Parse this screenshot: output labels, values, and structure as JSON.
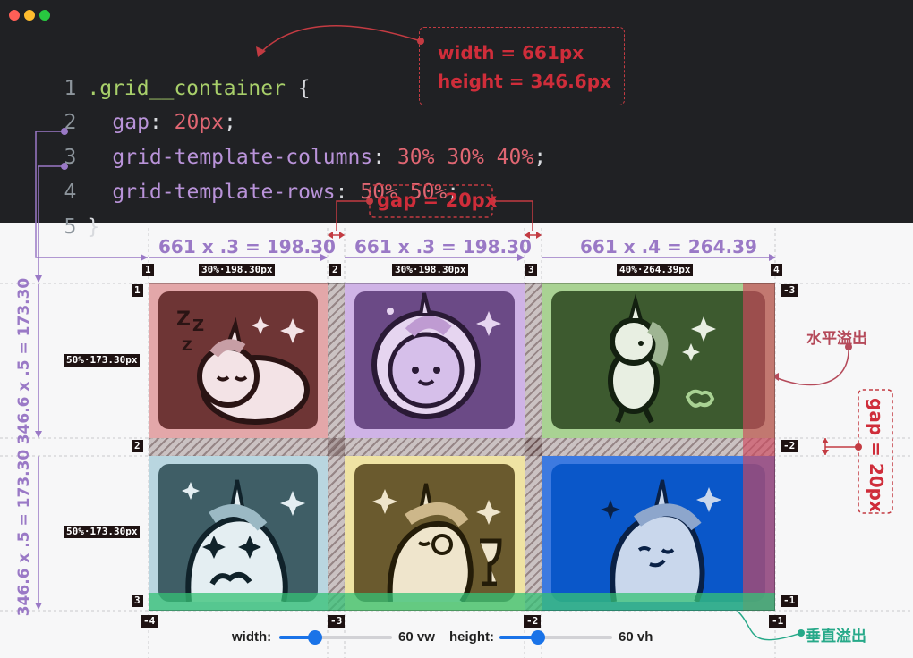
{
  "editor": {
    "lines": [
      {
        "num": "1",
        "selector": ".grid__container",
        "brace": " {"
      },
      {
        "num": "2",
        "prop": "gap",
        "colon": ": ",
        "value": "20px",
        "end": ";"
      },
      {
        "num": "3",
        "prop": "grid-template-columns",
        "colon": ": ",
        "value": "30% 30% 40%",
        "end": ";"
      },
      {
        "num": "4",
        "prop": "grid-template-rows",
        "colon": ": ",
        "value": "50% 50%",
        "end": ";"
      },
      {
        "num": "5",
        "brace": "}"
      }
    ],
    "size_callout": {
      "width": "width  = 661px",
      "height": "height = 346.6px"
    }
  },
  "annotations": {
    "gap_top": "gap = 20px",
    "gap_right": "gap = 20px",
    "col_calcs": [
      "661 x .3 = 198.30",
      "661 x .3 = 198.30",
      "661 x .4 = 264.39"
    ],
    "row_calcs": [
      "346.6 x .5 = 173.30",
      "346.6 x .5 = 173.30"
    ],
    "col_tags": [
      "30%·198.30px",
      "30%·198.30px",
      "40%·264.39px"
    ],
    "row_tags": [
      "50%·173.30px",
      "50%·173.30px"
    ],
    "overflow_horizontal": "水平溢出",
    "overflow_vertical": "垂直溢出"
  },
  "grid_lines": {
    "col_top": [
      "1",
      "2",
      "3",
      "4"
    ],
    "col_bottom": [
      "-4",
      "-3",
      "-2",
      "-1"
    ],
    "row_left": [
      "1",
      "2",
      "3"
    ],
    "row_right": [
      "-3",
      "-2",
      "-1"
    ]
  },
  "cells": [
    {
      "name": "sleeping-unicorn",
      "bg": "#e3a7a9",
      "card": "#6e3535"
    },
    {
      "name": "unicorn-bubble",
      "bg": "#cfb3e6",
      "card": "#6b4a86"
    },
    {
      "name": "running-unicorn",
      "bg": "#a9d293",
      "card": "#3d5a2f"
    },
    {
      "name": "starry-eyed-unicorn",
      "bg": "#b9d6e0",
      "card": "#3f5e66"
    },
    {
      "name": "fancy-unicorn",
      "bg": "#efe3a3",
      "card": "#6a5a2e"
    },
    {
      "name": "winking-unicorn",
      "bg": "#3d7ae0",
      "card": "#0a57c9"
    }
  ],
  "controls": {
    "width_label": "width:",
    "width_value": "60 vw",
    "width_fraction": 0.32,
    "height_label": "height:",
    "height_value": "60 vh",
    "height_fraction": 0.34
  },
  "colors": {
    "code_bg": "#202124",
    "selector": "#a8cf6a",
    "property": "#b993d9",
    "value": "#e06672",
    "annotation_red": "#cf2d3a",
    "annotation_purple": "#9a79c6",
    "overflow_h": "#d0485e",
    "overflow_v": "#35c276",
    "annotation_teal": "#27a989"
  }
}
